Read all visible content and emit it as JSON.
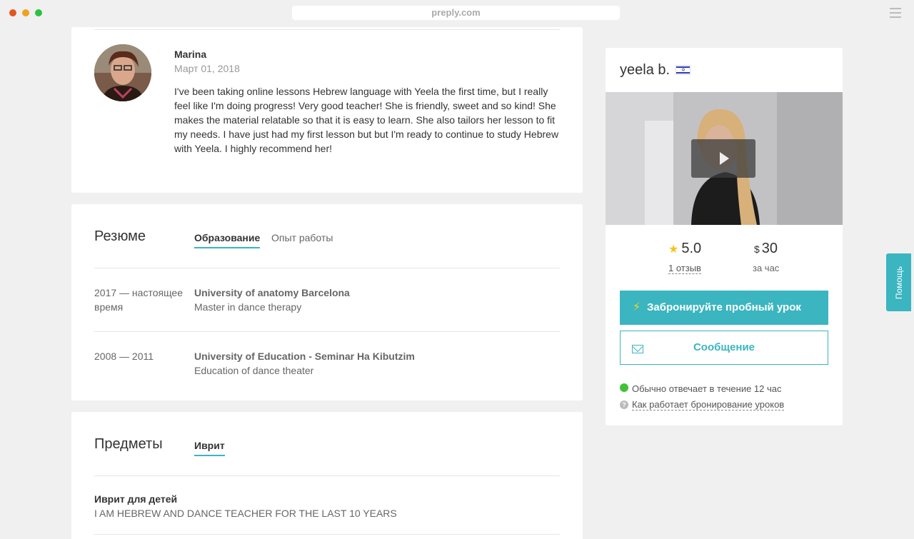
{
  "browser": {
    "url": "preply.com"
  },
  "review": {
    "name": "Marina",
    "date": "Март 01, 2018",
    "text": "I've been taking online lessons Hebrew language with Yeela the first time, but I really feel like I'm doing progress! Very good teacher! She is friendly, sweet and so kind! She makes the material relatable so that it is easy to learn. She also tailors her lesson to fit my needs. I have just had my first lesson but but I'm ready to continue to study Hebrew with Yeela. I highly recommend her!"
  },
  "resume": {
    "title": "Резюме",
    "tabs": [
      {
        "label": "Образование",
        "active": true
      },
      {
        "label": "Опыт работы",
        "active": false
      }
    ],
    "entries": [
      {
        "period": "2017 — настоящее время",
        "school": "University of anatomy Barcelona",
        "degree": "Master in dance therapy"
      },
      {
        "period": "2008 — 2011",
        "school": "University of Education - Seminar Ha Kibutzim",
        "degree": "Education of dance theater"
      }
    ]
  },
  "subjects": {
    "title": "Предметы",
    "tabs": [
      {
        "label": "Иврит",
        "active": true
      }
    ],
    "items": [
      {
        "title": "Иврит для детей",
        "description": "I AM HEBREW AND DANCE TEACHER FOR THE LAST 10 YEARS"
      }
    ]
  },
  "sidebar": {
    "tutor_name": "yeela b.",
    "flag_icon": "israel-flag-icon",
    "rating": "5.0",
    "reviews_label": "1 отзыв",
    "currency": "$",
    "price": "30",
    "per_hour": "за час",
    "book_label": "Забронируйте пробный урок",
    "message_label": "Сообщение",
    "response_text": "Обычно отвечает в течение 12 час",
    "how_link": "Как работает бронирование уроков"
  },
  "help": {
    "label": "Помощь"
  },
  "colors": {
    "accent": "#3bb5c0",
    "star": "#f6c21a",
    "online": "#3ec336"
  }
}
